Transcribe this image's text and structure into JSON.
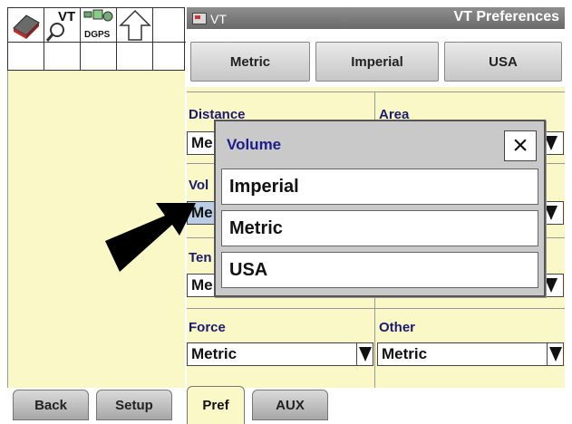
{
  "left_icons": {
    "vt_label": "VT",
    "dgps_label": "DGPS"
  },
  "window": {
    "tab_label": "VT",
    "title": "VT Preferences"
  },
  "unit_buttons": [
    "Metric",
    "Imperial",
    "USA"
  ],
  "fields": {
    "distance": {
      "label": "Distance",
      "value": "Me"
    },
    "area": {
      "label": "Area"
    },
    "volume": {
      "label": "Vol",
      "value": "Me"
    },
    "temperature": {
      "label": "Ten",
      "value": "Me"
    },
    "force": {
      "label": "Force",
      "value": "Metric"
    },
    "other": {
      "label": "Other",
      "value": "Metric"
    }
  },
  "popup": {
    "title": "Volume",
    "close_symbol": "×",
    "options": [
      "Imperial",
      "Metric",
      "USA"
    ]
  },
  "tabs": {
    "back": "Back",
    "setup": "Setup",
    "pref": "Pref",
    "aux": "AUX"
  },
  "colors": {
    "panel_bg": "#fbf8c7",
    "title_bar": "#7a7a7a",
    "label_text": "#1a1a70"
  }
}
